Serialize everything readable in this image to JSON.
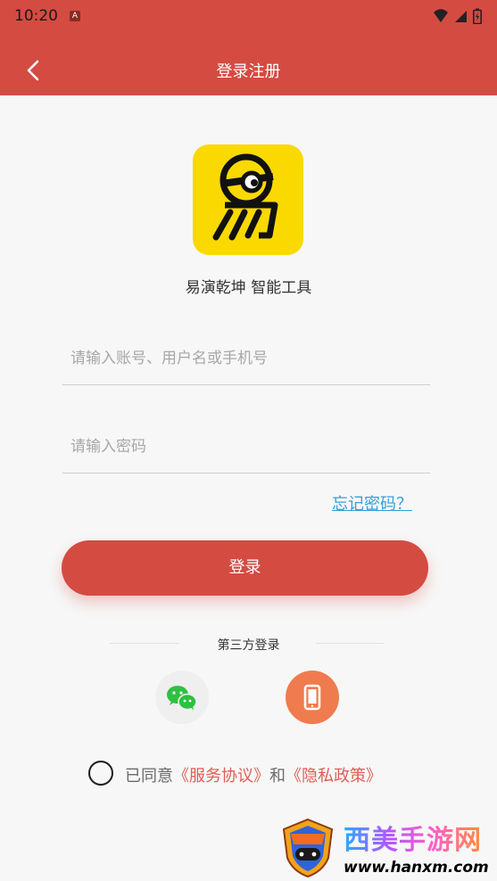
{
  "status_bar": {
    "time": "10:20",
    "notification_badge": "A"
  },
  "header": {
    "title": "登录注册"
  },
  "app": {
    "name": "易演乾坤 智能工具"
  },
  "form": {
    "account_placeholder": "请输入账号、用户名或手机号",
    "password_placeholder": "请输入密码",
    "forgot_link": "忘记密码？",
    "login_button": "登录"
  },
  "third_party": {
    "label": "第三方登录"
  },
  "agreement": {
    "prefix": "已同意",
    "terms_link": "《服务协议》",
    "connector": "和",
    "privacy_link": "《隐私政策》"
  },
  "watermark": {
    "title": "西美手游网",
    "url": "www.hanxm.com"
  },
  "colors": {
    "primary": "#d44b42",
    "link": "#35a0d8",
    "logo_bg": "#fad900",
    "wechat": "#2dc141",
    "phone": "#f07b4e"
  }
}
